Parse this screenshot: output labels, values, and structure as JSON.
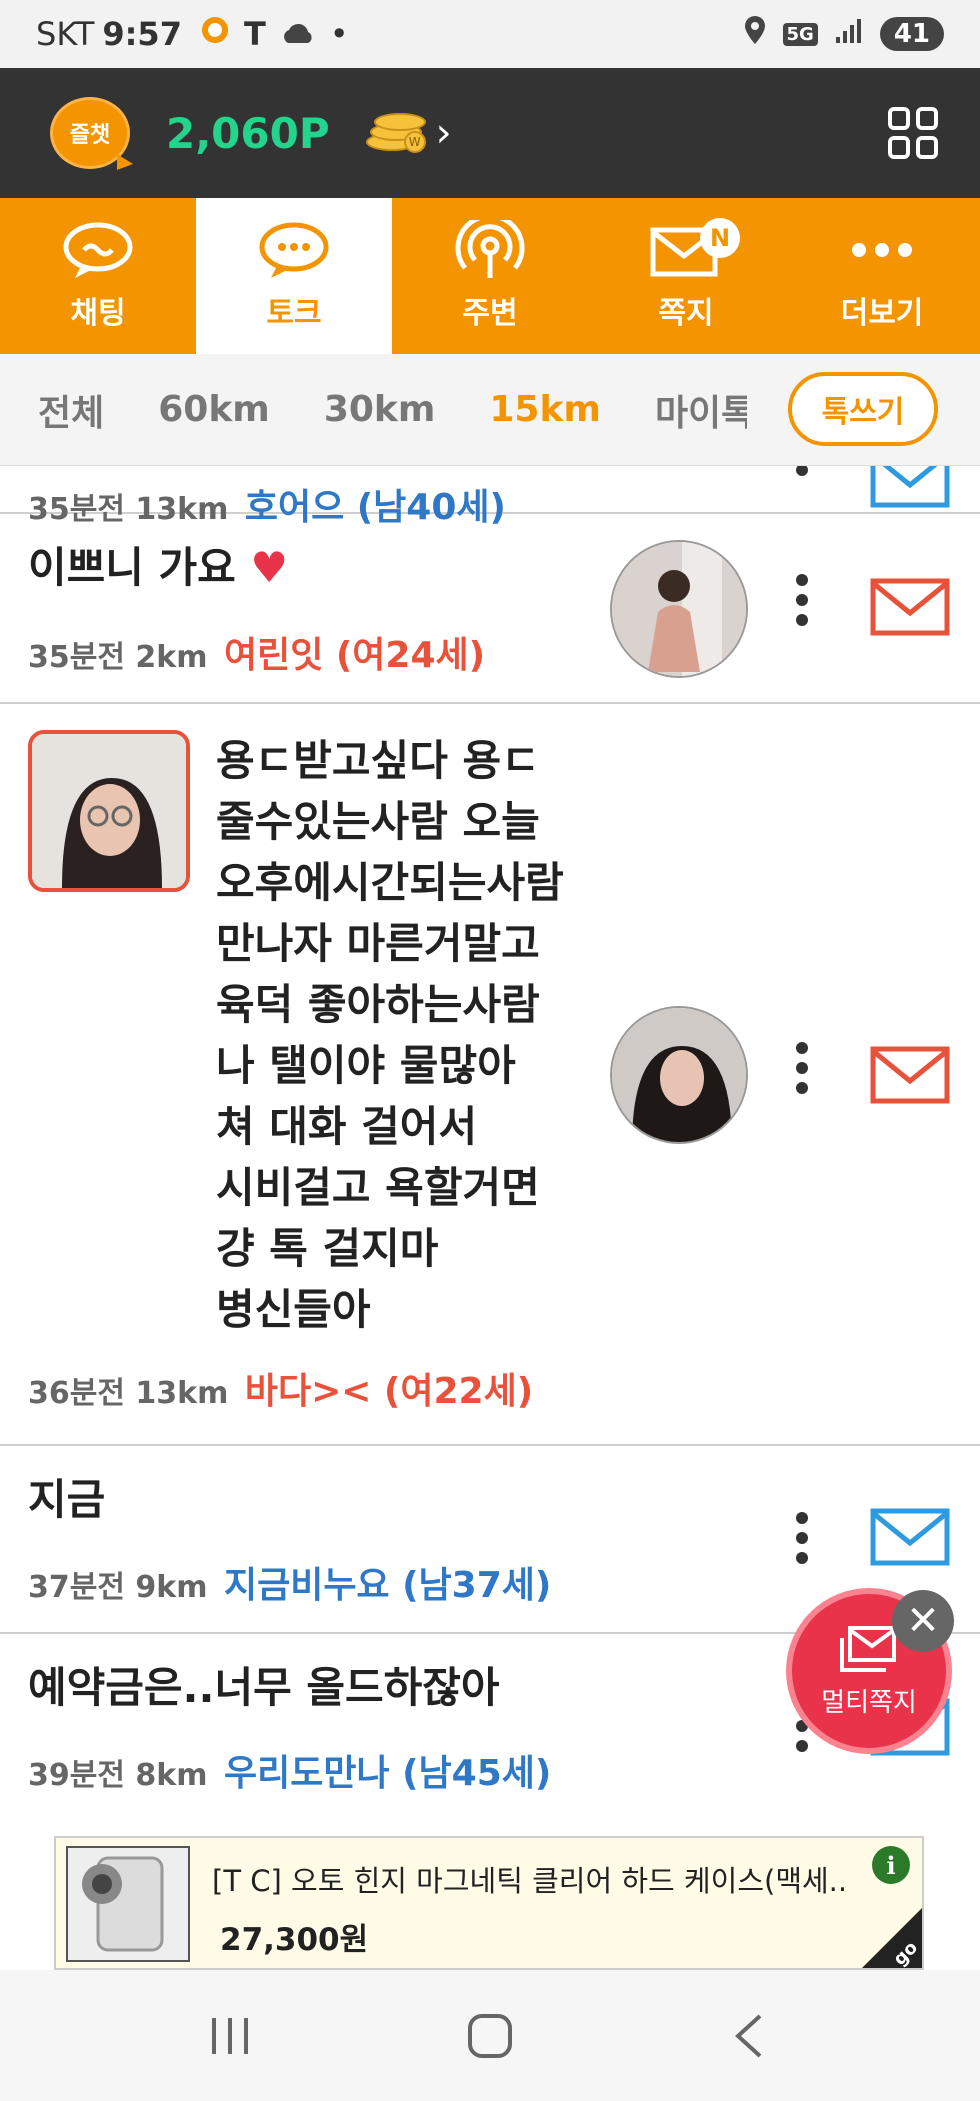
{
  "status_bar": {
    "carrier": "SKT",
    "time": "9:57",
    "t_glyph": "T",
    "network": "5G",
    "battery": "41"
  },
  "header": {
    "logo_text": "즐챗",
    "points": "2,060P",
    "chevron": "›",
    "coin_letter": "W"
  },
  "tabs": [
    {
      "label": "채팅",
      "icon": "chat-bubble-wave"
    },
    {
      "label": "토크",
      "icon": "chat-bubble-dots"
    },
    {
      "label": "주변",
      "icon": "broadcast"
    },
    {
      "label": "쪽지",
      "icon": "envelope",
      "badge": "N"
    },
    {
      "label": "더보기",
      "icon": "more-dots"
    }
  ],
  "filters": {
    "items": [
      "전체",
      "60km",
      "30km",
      "15km",
      "마이톡"
    ],
    "active": "15km",
    "write_button": "톡쓰기"
  },
  "posts": [
    {
      "title": "",
      "time": "35분전",
      "distance": "13km",
      "nickname": "호어으 (남40세)",
      "gender": "male"
    },
    {
      "title": "이쁘니 가요",
      "emoji": "♥",
      "time": "35분전",
      "distance": "2km",
      "nickname": "여린잇 (여24세)",
      "gender": "female"
    },
    {
      "lines": [
        "용ㄷ받고싶다 용ㄷ",
        "줄수있는사람 오늘",
        "오후에시간되는사람",
        "만나자 마른거말고",
        "육덕 좋아하는사람",
        "나 탤이야 물많아",
        "쳐 대화 걸어서",
        "시비걸고 욕할거면",
        "걍 톡 걸지마",
        "병신들아"
      ],
      "time": "36분전",
      "distance": "13km",
      "nickname": "바다>< (여22세)",
      "gender": "female"
    },
    {
      "title": "지금",
      "time": "37분전",
      "distance": "9km",
      "nickname": "지금비누요 (남37세)",
      "gender": "male"
    },
    {
      "title": "예약금은..너무 올드하잖아",
      "time": "39분전",
      "distance": "8km",
      "nickname": "우리도만나 (남45세)",
      "gender": "male"
    }
  ],
  "multi_message": {
    "label": "멀티쪽지",
    "close": "✕"
  },
  "ad": {
    "title": "[T C] 오토 힌지 마그네틱 클리어 하드 케이스(맥세..",
    "price": "27,300원",
    "info": "i",
    "go": "go"
  },
  "colors": {
    "orange": "#f39400",
    "header_dark": "#333333",
    "points_green": "#22d48c",
    "male_blue": "#2e78c7",
    "female_red": "#e8513a",
    "multi_red": "#e8334a"
  }
}
